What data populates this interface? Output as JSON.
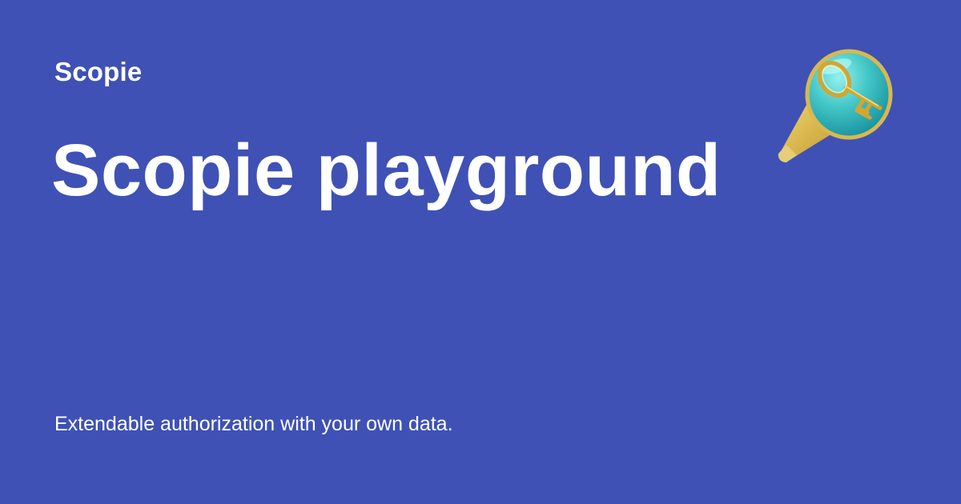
{
  "card": {
    "brand": "Scopie",
    "title": "Scopie playground",
    "subtitle": "Extendable authorization with your own data."
  },
  "colors": {
    "background": "#3f51b5",
    "text": "#ffffff",
    "logo_gold": "#d8b84f",
    "logo_teal": "#3ec8c9"
  },
  "logo": {
    "icon": "key-pointer-icon"
  }
}
